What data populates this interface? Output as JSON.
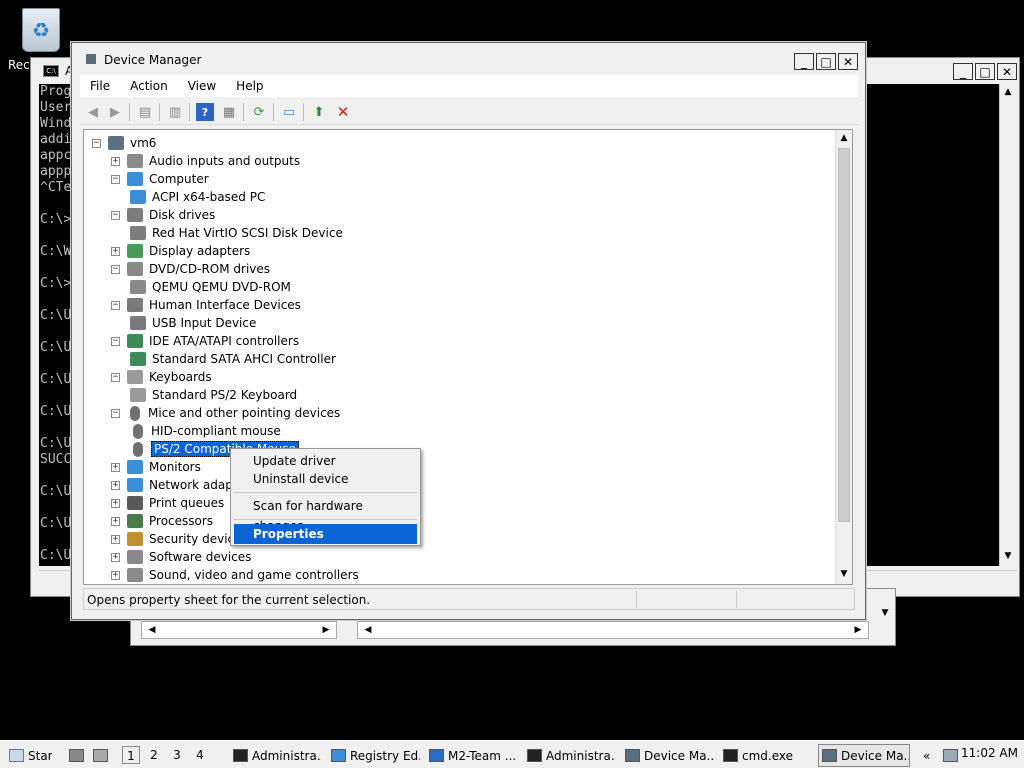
{
  "desktop": {
    "recycle_label": "Recy"
  },
  "cmd_window": {
    "title": "A",
    "lines": [
      "Prog",
      "User",
      "Wind",
      "addi",
      "appc",
      "appp",
      "^CTe",
      "",
      "C:\\>",
      "",
      "C:\\W",
      "",
      "C:\\>",
      "",
      "C:\\U",
      "",
      "C:\\U",
      "",
      "C:\\U",
      "",
      "C:\\U",
      "",
      "C:\\U",
      "SUCC",
      "",
      "C:\\U",
      "",
      "C:\\U",
      "",
      "C:\\U"
    ]
  },
  "device_manager": {
    "title": "Device Manager",
    "menu": [
      "File",
      "Action",
      "View",
      "Help"
    ],
    "status": "Opens property sheet for the current selection.",
    "tree": [
      {
        "label": "vm6",
        "level": 0,
        "exp": "−",
        "icon": "computer-icon",
        "color": "#5b6f80"
      },
      {
        "label": "Audio inputs and outputs",
        "level": 1,
        "exp": "+",
        "icon": "speaker-icon",
        "color": "#8a8a8a"
      },
      {
        "label": "Computer",
        "level": 1,
        "exp": "−",
        "icon": "monitor-icon",
        "color": "#3b8fd8"
      },
      {
        "label": "ACPI x64-based PC",
        "level": 2,
        "exp": "",
        "icon": "monitor-icon",
        "color": "#3b8fd8"
      },
      {
        "label": "Disk drives",
        "level": 1,
        "exp": "−",
        "icon": "disk-icon",
        "color": "#7d7d7d"
      },
      {
        "label": "Red Hat VirtIO SCSI Disk Device",
        "level": 2,
        "exp": "",
        "icon": "disk-icon",
        "color": "#7d7d7d"
      },
      {
        "label": "Display adapters",
        "level": 1,
        "exp": "+",
        "icon": "display-adapter-icon",
        "color": "#4a9a5a"
      },
      {
        "label": "DVD/CD-ROM drives",
        "level": 1,
        "exp": "−",
        "icon": "dvd-icon",
        "color": "#8a8a8a"
      },
      {
        "label": "QEMU QEMU DVD-ROM",
        "level": 2,
        "exp": "",
        "icon": "dvd-icon",
        "color": "#8a8a8a"
      },
      {
        "label": "Human Interface Devices",
        "level": 1,
        "exp": "−",
        "icon": "hid-icon",
        "color": "#7a7a7a"
      },
      {
        "label": "USB Input Device",
        "level": 2,
        "exp": "",
        "icon": "hid-icon",
        "color": "#7a7a7a"
      },
      {
        "label": "IDE ATA/ATAPI controllers",
        "level": 1,
        "exp": "−",
        "icon": "controller-icon",
        "color": "#3e8b5a"
      },
      {
        "label": "Standard SATA AHCI Controller",
        "level": 2,
        "exp": "",
        "icon": "controller-icon",
        "color": "#3e8b5a"
      },
      {
        "label": "Keyboards",
        "level": 1,
        "exp": "−",
        "icon": "keyboard-icon",
        "color": "#9a9a9a"
      },
      {
        "label": "Standard PS/2 Keyboard",
        "level": 2,
        "exp": "",
        "icon": "keyboard-icon",
        "color": "#9a9a9a"
      },
      {
        "label": "Mice and other pointing devices",
        "level": 1,
        "exp": "−",
        "icon": "mouse-icon",
        "color": "#707070"
      },
      {
        "label": "HID-compliant mouse",
        "level": 2,
        "exp": "",
        "icon": "mouse-icon",
        "color": "#707070"
      },
      {
        "label": "PS/2 Compatible Mouse",
        "level": 2,
        "exp": "",
        "icon": "mouse-icon",
        "color": "#707070",
        "selected": true
      },
      {
        "label": "Monitors",
        "level": 1,
        "exp": "+",
        "icon": "monitor-icon",
        "color": "#3b8fd8"
      },
      {
        "label": "Network adapte",
        "level": 1,
        "exp": "+",
        "icon": "network-icon",
        "color": "#3b8fd8"
      },
      {
        "label": "Print queues",
        "level": 1,
        "exp": "+",
        "icon": "printer-icon",
        "color": "#5a5a5a"
      },
      {
        "label": "Processors",
        "level": 1,
        "exp": "+",
        "icon": "processor-icon",
        "color": "#4a7a4a"
      },
      {
        "label": "Security devices",
        "level": 1,
        "exp": "+",
        "icon": "security-icon",
        "color": "#c09030"
      },
      {
        "label": "Software devices",
        "level": 1,
        "exp": "+",
        "icon": "software-icon",
        "color": "#8a8a8a"
      },
      {
        "label": "Sound, video and game controllers",
        "level": 1,
        "exp": "+",
        "icon": "sound-icon",
        "color": "#8a8a8a"
      }
    ]
  },
  "context_menu": {
    "items": [
      "Update driver",
      "Uninstall device",
      "Scan for hardware changes",
      "Properties"
    ],
    "highlighted": "Properties"
  },
  "taskbar": {
    "start": "Start",
    "desktops": [
      "1",
      "2",
      "3",
      "4"
    ],
    "tasks": [
      "Administra...",
      "Registry Ed...",
      "M2-Team ...",
      "Administra...",
      "Device Ma...",
      "cmd.exe",
      "Device Ma..."
    ],
    "clock": "11:02 AM"
  },
  "colors": {
    "selection": "#0a64d6",
    "delete_red": "#d42020"
  }
}
